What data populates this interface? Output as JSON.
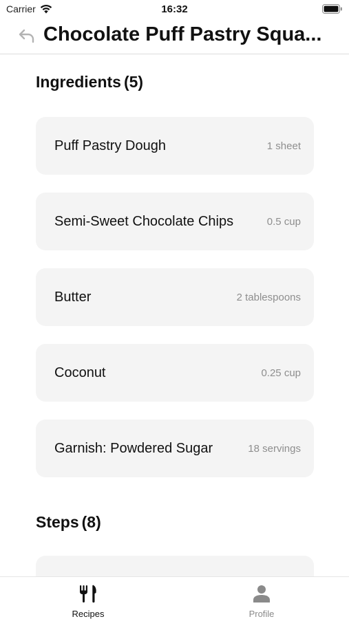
{
  "status_bar": {
    "carrier": "Carrier",
    "time": "16:32",
    "icons": [
      "wifi-icon",
      "battery-icon"
    ]
  },
  "header": {
    "title": "Chocolate Puff Pastry Squa...",
    "back_icon": "back-arrow-icon"
  },
  "ingredients": {
    "label": "Ingredients",
    "count": "(5)",
    "items": [
      {
        "name": "Puff Pastry Dough",
        "quantity": "1 sheet"
      },
      {
        "name": "Semi-Sweet Chocolate Chips",
        "quantity": "0.5 cup"
      },
      {
        "name": "Butter",
        "quantity": "2 tablespoons"
      },
      {
        "name": "Coconut",
        "quantity": "0.25 cup"
      },
      {
        "name": "Garnish: Powdered Sugar",
        "quantity": "18 servings"
      }
    ]
  },
  "steps": {
    "label": "Steps",
    "count": "(8)"
  },
  "tab_bar": {
    "active_color": "#111111",
    "inactive_color": "#8a8a8a",
    "tabs": [
      {
        "label": "Recipes",
        "icon": "fork-knife-icon",
        "active": true
      },
      {
        "label": "Profile",
        "icon": "person-icon",
        "active": false
      }
    ]
  }
}
